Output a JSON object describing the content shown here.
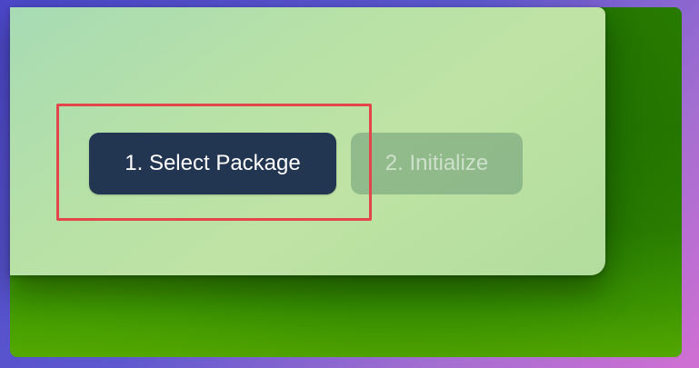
{
  "steps": [
    {
      "label": "1. Select Package",
      "state": "active"
    },
    {
      "label": "2. Initialize",
      "state": "disabled"
    }
  ],
  "colors": {
    "primary_button": "#233651",
    "highlight": "#e3454b",
    "panel": "#b7e1a7"
  }
}
